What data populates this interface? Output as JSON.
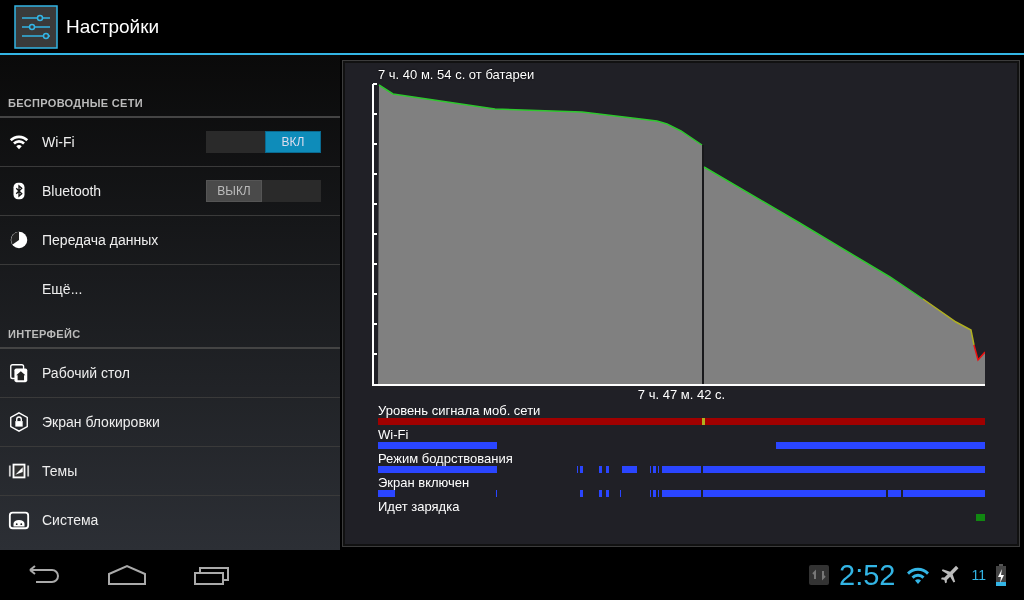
{
  "action_bar": {
    "title": "Настройки"
  },
  "sections": [
    {
      "title": "БЕСПРОВОДНЫЕ СЕТИ",
      "items": [
        {
          "kind": "toggle",
          "label": "Wi-Fi",
          "toggle": {
            "on": true,
            "label": "ВКЛ"
          }
        },
        {
          "kind": "toggle",
          "label": "Bluetooth",
          "toggle": {
            "on": false,
            "label": "ВЫКЛ"
          }
        },
        {
          "kind": "plain",
          "label": "Передача данных"
        },
        {
          "kind": "plain",
          "label": "Ещё..."
        }
      ]
    },
    {
      "title": "ИНТЕРФЕЙС",
      "items": [
        {
          "kind": "plain",
          "label": "Рабочий стол"
        },
        {
          "kind": "plain",
          "label": "Экран блокировки"
        },
        {
          "kind": "plain",
          "label": "Темы"
        },
        {
          "kind": "plain",
          "label": "Система"
        }
      ]
    }
  ],
  "battery": {
    "title": "7 ч. 40 м. 54 с. от батареи",
    "time_label": "7 ч. 47 м. 42 с.",
    "tracks": [
      {
        "label": "Уровень сигнала моб. сети"
      },
      {
        "label": "Wi-Fi"
      },
      {
        "label": "Режим бодрствования"
      },
      {
        "label": "Экран включен"
      },
      {
        "label": "Идет зарядка"
      }
    ]
  },
  "status_bar": {
    "time": "2:52",
    "battery_text": "11"
  }
}
